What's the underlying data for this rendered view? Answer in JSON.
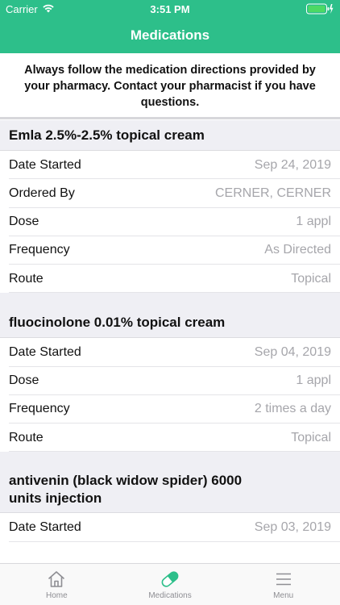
{
  "status_bar": {
    "carrier": "Carrier",
    "time": "3:51 PM"
  },
  "nav": {
    "title": "Medications"
  },
  "notice": {
    "text": "Always follow the medication directions provided by your pharmacy. Contact your pharmacist if you have questions."
  },
  "medications": [
    {
      "name": "Emla 2.5%-2.5% topical cream",
      "fields": [
        {
          "label": "Date Started",
          "value": "Sep 24, 2019"
        },
        {
          "label": "Ordered By",
          "value": "CERNER, CERNER"
        },
        {
          "label": "Dose",
          "value": "1 appl"
        },
        {
          "label": "Frequency",
          "value": "As Directed"
        },
        {
          "label": "Route",
          "value": "Topical"
        }
      ]
    },
    {
      "name": "fluocinolone 0.01% topical cream",
      "fields": [
        {
          "label": "Date Started",
          "value": "Sep 04, 2019"
        },
        {
          "label": "Dose",
          "value": "1 appl"
        },
        {
          "label": "Frequency",
          "value": "2 times a day"
        },
        {
          "label": "Route",
          "value": "Topical"
        }
      ]
    },
    {
      "name": "antivenin (black widow spider) 6000 units injection",
      "fields": [
        {
          "label": "Date Started",
          "value": "Sep 03, 2019"
        }
      ]
    }
  ],
  "tabs": [
    {
      "label": "Home",
      "icon": "home-icon"
    },
    {
      "label": "Medications",
      "icon": "pill-icon"
    },
    {
      "label": "Menu",
      "icon": "menu-icon"
    }
  ],
  "colors": {
    "brand": "#2dbf8a",
    "battery": "#4cd964",
    "secondary_text": "#a6a6ab",
    "section_bg": "#efeff4"
  }
}
